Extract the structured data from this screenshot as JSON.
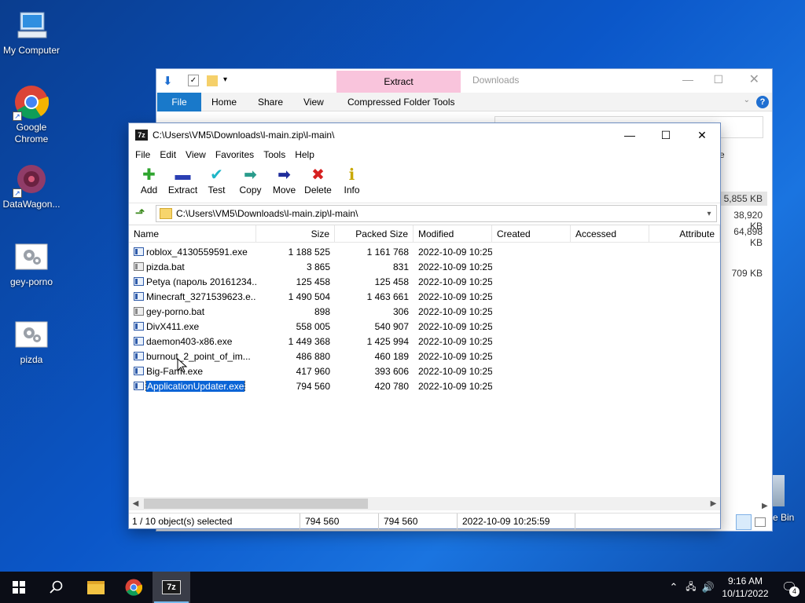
{
  "desktop": {
    "icons": [
      {
        "label": "My Computer"
      },
      {
        "label": "Google Chrome"
      },
      {
        "label": "DataWagon..."
      },
      {
        "label": "gey-porno"
      },
      {
        "label": "pizda"
      }
    ],
    "recycle_bin_partial": "e Bin"
  },
  "explorer": {
    "title": "Downloads",
    "context_tab": "Extract",
    "tabs": [
      "File",
      "Home",
      "Share",
      "View",
      "Compressed Folder Tools"
    ],
    "side_sizes": [
      "5,855 KB",
      "38,920 KB",
      "64,898 KB",
      "709 KB"
    ],
    "side_partial": "e"
  },
  "zip": {
    "title": "C:\\Users\\VM5\\Downloads\\l-main.zip\\l-main\\",
    "menu": [
      "File",
      "Edit",
      "View",
      "Favorites",
      "Tools",
      "Help"
    ],
    "toolbar": [
      {
        "label": "Add",
        "icon": "add-icon",
        "color": "#2fa52f"
      },
      {
        "label": "Extract",
        "icon": "extract-icon",
        "color": "#2b3fb3"
      },
      {
        "label": "Test",
        "icon": "test-icon",
        "color": "#1fb6c7"
      },
      {
        "label": "Copy",
        "icon": "copy-icon",
        "color": "#2a9c8c"
      },
      {
        "label": "Move",
        "icon": "move-icon",
        "color": "#1f2d9b"
      },
      {
        "label": "Delete",
        "icon": "delete-icon",
        "color": "#d62020"
      },
      {
        "label": "Info",
        "icon": "info-icon",
        "color": "#c9a800"
      }
    ],
    "address": "C:\\Users\\VM5\\Downloads\\l-main.zip\\l-main\\",
    "columns": [
      "Name",
      "Size",
      "Packed Size",
      "Modified",
      "Created",
      "Accessed",
      "Attribute"
    ],
    "files": [
      {
        "name": "roblox_4130559591.exe",
        "size": "1 188 525",
        "packed": "1 161 768",
        "modified": "2022-10-09 10:25",
        "type": "exe"
      },
      {
        "name": "pizda.bat",
        "size": "3 865",
        "packed": "831",
        "modified": "2022-10-09 10:25",
        "type": "bat"
      },
      {
        "name": "Petya (пароль 20161234...",
        "size": "125 458",
        "packed": "125 458",
        "modified": "2022-10-09 10:25",
        "type": "archive"
      },
      {
        "name": "Minecraft_3271539623.e...",
        "size": "1 490 504",
        "packed": "1 463 661",
        "modified": "2022-10-09 10:25",
        "type": "exe"
      },
      {
        "name": "gey-porno.bat",
        "size": "898",
        "packed": "306",
        "modified": "2022-10-09 10:25",
        "type": "bat"
      },
      {
        "name": "DivX411.exe",
        "size": "558 005",
        "packed": "540 907",
        "modified": "2022-10-09 10:25",
        "type": "exe"
      },
      {
        "name": "daemon403-x86.exe",
        "size": "1 449 368",
        "packed": "1 425 994",
        "modified": "2022-10-09 10:25",
        "type": "exe"
      },
      {
        "name": "burnout_2_point_of_im...",
        "size": "486 880",
        "packed": "460 189",
        "modified": "2022-10-09 10:25",
        "type": "exe"
      },
      {
        "name": "Big-Farm.exe",
        "size": "417 960",
        "packed": "393 606",
        "modified": "2022-10-09 10:25",
        "type": "exe"
      },
      {
        "name": "ApplicationUpdater.exe",
        "size": "794 560",
        "packed": "420 780",
        "modified": "2022-10-09 10:25",
        "type": "exe",
        "selected": true
      }
    ],
    "status": {
      "selection": "1 / 10 object(s) selected",
      "size": "794 560",
      "packed": "794 560",
      "modified": "2022-10-09 10:25:59"
    }
  },
  "taskbar": {
    "time": "9:16 AM",
    "date": "10/11/2022",
    "notification_count": "4"
  }
}
